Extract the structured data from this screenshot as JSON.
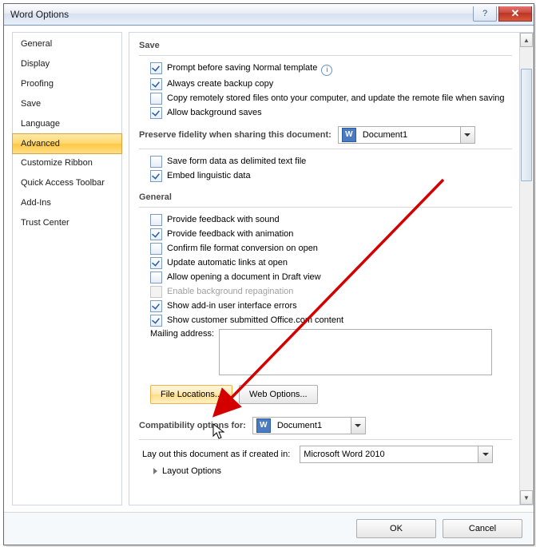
{
  "title": "Word Options",
  "sidebar": {
    "items": [
      {
        "label": "General"
      },
      {
        "label": "Display"
      },
      {
        "label": "Proofing"
      },
      {
        "label": "Save"
      },
      {
        "label": "Language"
      },
      {
        "label": "Advanced"
      },
      {
        "label": "Customize Ribbon"
      },
      {
        "label": "Quick Access Toolbar"
      },
      {
        "label": "Add-Ins"
      },
      {
        "label": "Trust Center"
      }
    ],
    "active_index": 5
  },
  "sections": {
    "save": {
      "title": "Save",
      "items": [
        {
          "checked": true,
          "label": "Prompt before saving Normal template",
          "info": true
        },
        {
          "checked": true,
          "label": "Always create backup copy"
        },
        {
          "checked": false,
          "label": "Copy remotely stored files onto your computer, and update the remote file when saving"
        },
        {
          "checked": true,
          "label": "Allow background saves"
        }
      ]
    },
    "preserve": {
      "title": "Preserve fidelity when sharing this document:",
      "combo_value": "Document1",
      "items": [
        {
          "checked": false,
          "label": "Save form data as delimited text file"
        },
        {
          "checked": true,
          "label": "Embed linguistic data"
        }
      ]
    },
    "general": {
      "title": "General",
      "items": [
        {
          "checked": false,
          "label": "Provide feedback with sound"
        },
        {
          "checked": true,
          "label": "Provide feedback with animation"
        },
        {
          "checked": false,
          "label": "Confirm file format conversion on open"
        },
        {
          "checked": true,
          "label": "Update automatic links at open"
        },
        {
          "checked": false,
          "label": "Allow opening a document in Draft view"
        },
        {
          "checked": false,
          "label": "Enable background repagination",
          "disabled": true
        },
        {
          "checked": true,
          "label": "Show add-in user interface errors"
        },
        {
          "checked": true,
          "label": "Show customer submitted Office.com content"
        }
      ],
      "mailing_label": "Mailing address:",
      "file_locations_btn": "File Locations...",
      "web_options_btn": "Web Options..."
    },
    "compat": {
      "title": "Compatibility options for:",
      "combo_value": "Document1",
      "layout_label": "Lay out this document as if created in:",
      "layout_value": "Microsoft Word 2010",
      "layout_options": "Layout Options"
    }
  },
  "footer": {
    "ok": "OK",
    "cancel": "Cancel"
  }
}
